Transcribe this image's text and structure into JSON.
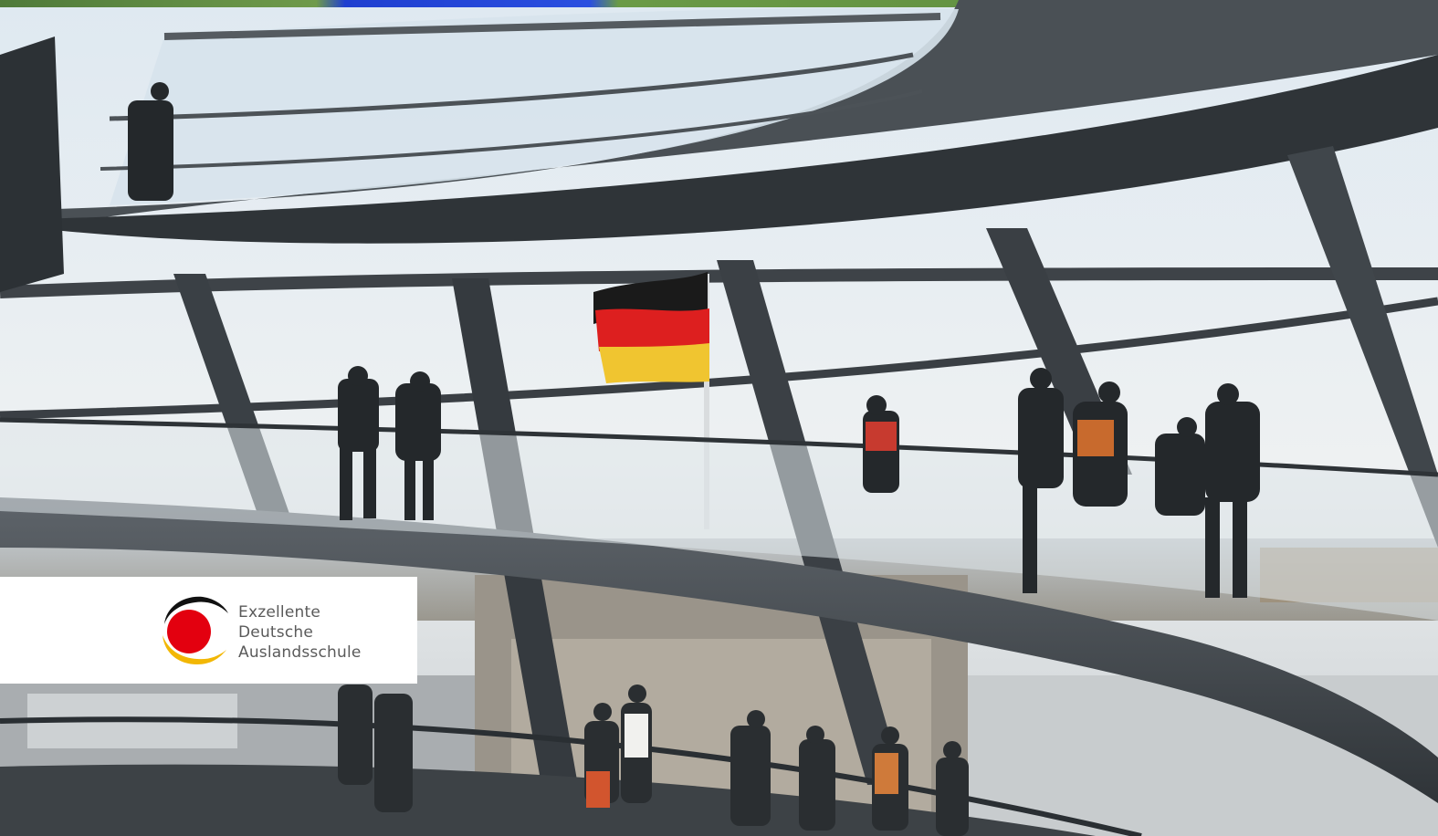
{
  "logo": {
    "line1": "Exzellente",
    "line2": "Deutsche",
    "line3": "Auslandsschule",
    "colors": {
      "black": "#111111",
      "red": "#e3000f",
      "gold": "#f2b705"
    }
  },
  "scene": {
    "sky": "#e6edf2",
    "structure": "#3c4247",
    "flag_colors": [
      "#1a1a1a",
      "#dd1f1f",
      "#f0c530"
    ]
  }
}
